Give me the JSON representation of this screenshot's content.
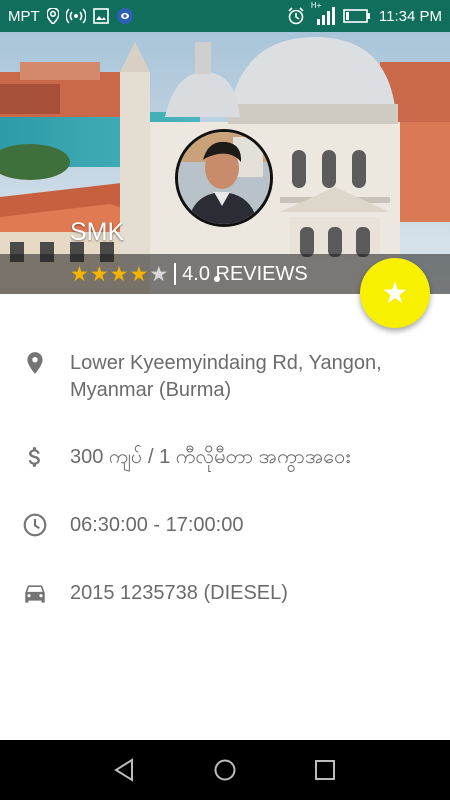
{
  "status_bar": {
    "carrier": "MPT",
    "network_type": "H+",
    "time": "11:34 PM",
    "icons": [
      "location-icon",
      "hotspot-icon",
      "gallery-icon",
      "vpn-icon",
      "alarm-icon",
      "signal-icon",
      "battery-icon"
    ]
  },
  "driver": {
    "name": "SMK",
    "rating": 4.0,
    "rating_text": "4.0 REVIEWS",
    "stars": [
      "filled",
      "filled",
      "filled",
      "filled",
      "empty"
    ]
  },
  "fab": {
    "icon": "star-icon",
    "color": "#f7f000"
  },
  "details": {
    "address": "Lower Kyeemyindaing Rd, Yangon, Myanmar (Burma)",
    "price": "300 ကျပ် / 1 ကီလိုမီတာ အကွာအဝေး",
    "hours": "06:30:00 - 17:00:00",
    "vehicle": "2015 1235738 (DIESEL)"
  },
  "colors": {
    "status_bar": "#0f6e5c",
    "star": "#f4b400",
    "text": "#6b6b6b",
    "icon": "#757575"
  }
}
